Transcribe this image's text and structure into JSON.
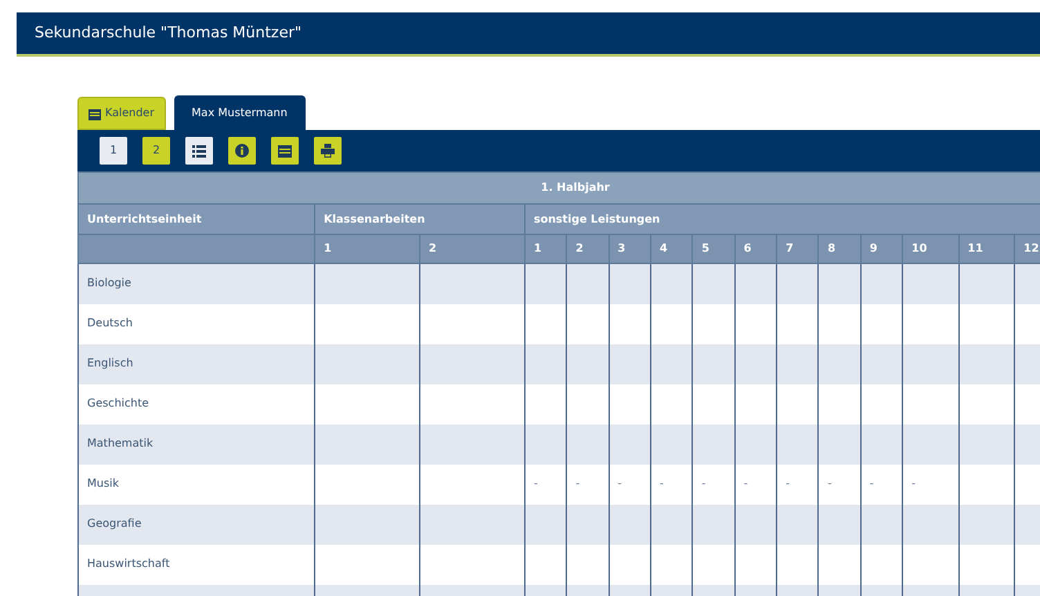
{
  "header": {
    "title": "Sekundarschule \"Thomas Müntzer\""
  },
  "tabs": [
    {
      "kind": "calendar",
      "label": "Kalender",
      "selected": false
    },
    {
      "kind": "student",
      "label": "Max Mustermann",
      "selected": true
    }
  ],
  "toolbar": [
    {
      "kind": "text",
      "label": "1",
      "active": true
    },
    {
      "kind": "text",
      "label": "2",
      "active": false
    },
    {
      "kind": "list",
      "active": true
    },
    {
      "kind": "info",
      "active": false
    },
    {
      "kind": "calendar",
      "active": false
    },
    {
      "kind": "print",
      "active": false
    }
  ],
  "table": {
    "period": "1. Halbjahr",
    "columns": [
      "Unterrichtseinheit",
      "Klassenarbeiten",
      "sonstige Leistungen"
    ],
    "klassenarbeiten_numbers": [
      "1",
      "2"
    ],
    "sonstige_numbers": [
      "1",
      "2",
      "3",
      "4",
      "5",
      "6",
      "7",
      "8",
      "9",
      "10",
      "11",
      "12"
    ],
    "rows": [
      {
        "subject": "Biologie"
      },
      {
        "subject": "Deutsch"
      },
      {
        "subject": "Englisch"
      },
      {
        "subject": "Geschichte"
      },
      {
        "subject": "Mathematik"
      },
      {
        "subject": "Musik",
        "sonstige": [
          "-",
          "-",
          "-",
          "-",
          "-",
          "-",
          "-",
          "-",
          "-",
          "-"
        ]
      },
      {
        "subject": "Geografie"
      },
      {
        "subject": "Hauswirtschaft"
      }
    ]
  }
}
